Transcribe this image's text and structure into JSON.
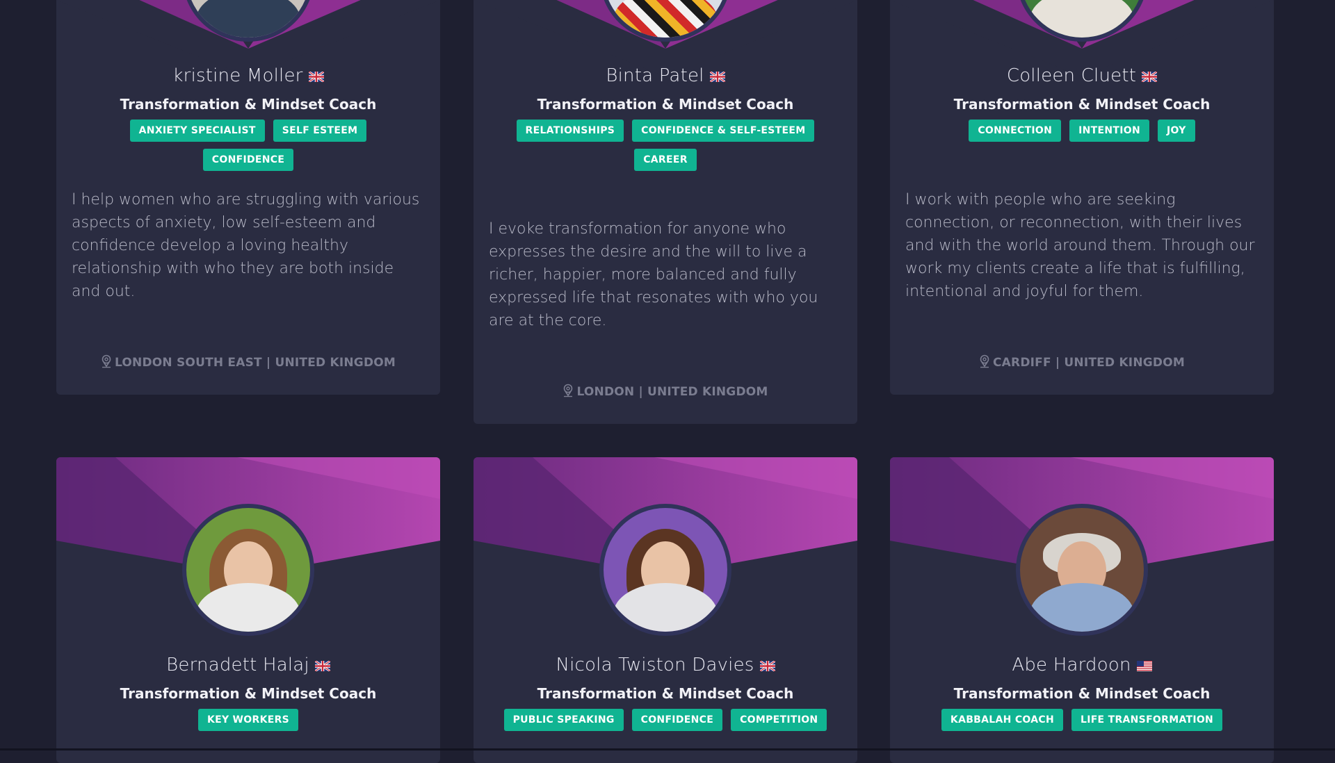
{
  "colors": {
    "page_bg": "#1e1f30",
    "card_bg": "#2a2c41",
    "tag_bg": "#10b492",
    "banner_purple": "#8e2f92",
    "banner_magenta": "#b446b0"
  },
  "coaches": [
    {
      "name": "kristine Moller",
      "flag": "uk-flag-icon",
      "role": "Transformation & Mindset Coach",
      "tags": [
        "ANXIETY SPECIALIST",
        "SELF ESTEEM",
        "CONFIDENCE"
      ],
      "bio": "I help women who are struggling with various aspects of anxiety, low self-esteem and confidence develop a loving healthy relationship with who they are both inside and out.",
      "location": "LONDON SOUTH EAST | UNITED KINGDOM"
    },
    {
      "name": "Binta Patel",
      "flag": "uk-flag-icon",
      "role": "Transformation & Mindset Coach",
      "tags": [
        "RELATIONSHIPS",
        "CONFIDENCE & SELF-ESTEEM",
        "CAREER"
      ],
      "bio": "I evoke transformation for anyone who expresses the desire and the will to live a richer, happier, more balanced and fully expressed life that resonates with who you are at the core.",
      "location": "LONDON | UNITED KINGDOM"
    },
    {
      "name": "Colleen Cluett",
      "flag": "uk-flag-icon",
      "role": "Transformation & Mindset Coach",
      "tags": [
        "CONNECTION",
        "INTENTION",
        "JOY"
      ],
      "bio": "I work with people who are seeking connection, or reconnection, with their lives and with the world around them. Through our work my clients create a life that is fulfilling, intentional and joyful for them.",
      "location": "CARDIFF | UNITED KINGDOM"
    },
    {
      "name": "Bernadett Halaj",
      "flag": "uk-flag-icon",
      "role": "Transformation & Mindset Coach",
      "tags": [
        "KEY WORKERS"
      ]
    },
    {
      "name": "Nicola Twiston Davies",
      "flag": "uk-flag-icon",
      "role": "Transformation & Mindset Coach",
      "tags": [
        "PUBLIC SPEAKING",
        "CONFIDENCE",
        "COMPETITION"
      ]
    },
    {
      "name": "Abe Hardoon",
      "flag": "us-flag-icon",
      "role": "Transformation & Mindset Coach",
      "tags": [
        "KABBALAH COACH",
        "LIFE TRANSFORMATION"
      ]
    }
  ]
}
